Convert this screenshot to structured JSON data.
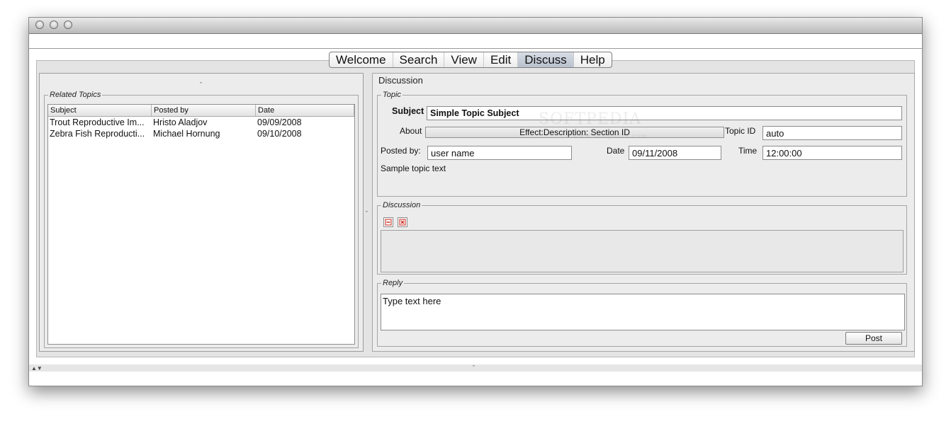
{
  "menu": {
    "items": [
      "Welcome",
      "Search",
      "View",
      "Edit",
      "Discuss",
      "Help"
    ],
    "active_index": 4
  },
  "related_topics": {
    "legend": "Related Topics",
    "columns": [
      "Subject",
      "Posted by",
      "Date"
    ],
    "rows": [
      [
        "Trout Reproductive Im...",
        "Hristo Aladjov",
        "09/09/2008"
      ],
      [
        "Zebra Fish Reproducti...",
        "Michael Hornung",
        "09/10/2008"
      ]
    ]
  },
  "discussion_panel": {
    "title": "Discussion",
    "topic": {
      "legend": "Topic",
      "subject_label": "Subject",
      "subject_value": "Simple Topic Subject",
      "about_label": "About",
      "about_value": "Effect:Description: Section ID",
      "topic_id_label": "Topic ID",
      "topic_id_value": "auto",
      "posted_by_label": "Posted by:",
      "posted_by_value": "user name",
      "date_label": "Date",
      "date_value": "09/11/2008",
      "time_label": "Time",
      "time_value": "12:00:00",
      "body_text": "Sample topic text"
    },
    "discussion": {
      "legend": "Discussion",
      "minimize_icon": "minus-icon",
      "close_icon": "close-x-icon"
    },
    "reply": {
      "legend": "Reply",
      "text": "Type text here",
      "post_label": "Post"
    }
  },
  "watermark": {
    "text": "SOFTPEDIA",
    "url": "www.softpedia.com"
  },
  "colors": {
    "active_tab": "#c2c9d4",
    "panel_bg": "#ececec",
    "close_red": "#cc2a1d"
  }
}
